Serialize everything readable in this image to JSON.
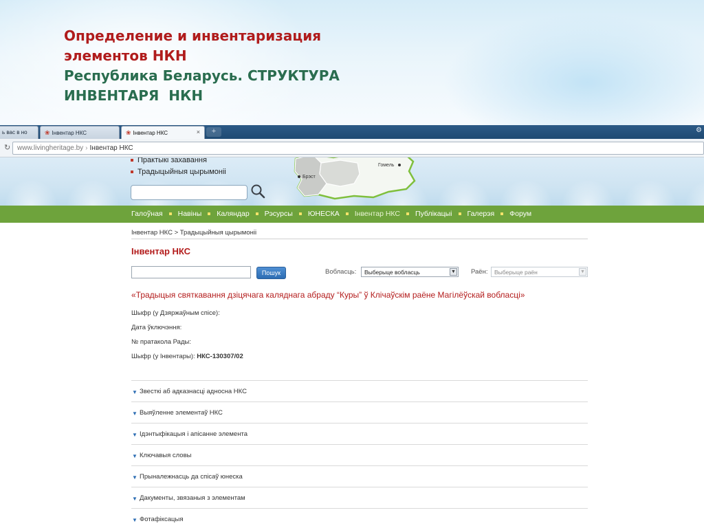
{
  "slide": {
    "title_line1": "Определение и инвентаризация",
    "title_line2": "элементов НКН",
    "title_line3": "Республика Беларусь. СТРУКТУРА",
    "title_line4": "ИНВЕНТАРЯ  НКН",
    "colors": {
      "red": "#b01c1c",
      "green": "#2a6d4f"
    }
  },
  "browser": {
    "tabs": [
      {
        "label": "ь вас в но"
      },
      {
        "label": "Інвентар НКС"
      },
      {
        "label": "Інвентар НКС",
        "active": true
      }
    ],
    "url_host": "www.livingheritage.by",
    "url_page": "Інвентар НКС"
  },
  "header": {
    "links": [
      "Практыкі захавання",
      "Традыцыйныя цырымоніі"
    ],
    "map_labels": {
      "brest": "Брэст",
      "homel": "Гомель"
    }
  },
  "nav": {
    "items": [
      "Галоўная",
      "Навіны",
      "Каляндар",
      "Рэсурсы",
      "ЮНЕСКА",
      "Інвентар НКС",
      "Публікацыі",
      "Галерэя",
      "Форум"
    ],
    "active": "Інвентар НКС",
    "color": "#6ea33c"
  },
  "content": {
    "breadcrumb": "Інвентар НКС > Традыцыйныя цырымоніі",
    "title": "Інвентар НКС",
    "search_button": "Пошук",
    "region_label": "Вобласць:",
    "region_value": "Выберыце вобласць",
    "district_label": "Раён:",
    "district_value": "Выберыце раён",
    "element_title": "«Традыцыя святкавання дзіцячага каляднага абраду “Куры” ў Клічаўскім раёне Магілёўскай вобласці»",
    "fields": {
      "state_code_label": "Шыфр (у Дзяржаўным спісе):",
      "date_label": "Дата ўключэння:",
      "protocol_label": "№ пратакола Рады:",
      "inventory_code_label": "Шыфр (у Інвентары):",
      "inventory_code_value": "НКС-130307/02"
    },
    "sections": [
      "Звесткі аб адказнасці адносна НКС",
      "Выяўленне элементаў НКС",
      "Ідэнтыфікацыя і апісанне элемента",
      "Ключавыя словы",
      "Прыналежнасць да спісаў юнеска",
      "Дакументы, звязаныя з элементам",
      "Фотафіксацыя"
    ]
  }
}
